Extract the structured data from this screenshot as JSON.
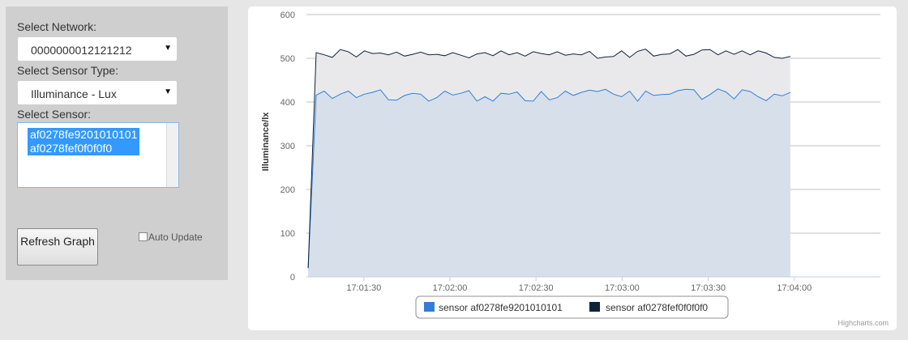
{
  "sidebar": {
    "network_label": "Select Network:",
    "network_value": "0000000012121212",
    "sensor_type_label": "Select Sensor Type:",
    "sensor_type_value": "Illuminance - Lux",
    "sensor_label": "Select Sensor:",
    "sensors": [
      "af0278fe9201010101",
      "af0278fef0f0f0f0"
    ],
    "refresh_label": "Refresh Graph",
    "auto_update_label": "Auto Update",
    "auto_update_checked": false
  },
  "credits": "Highcharts.com",
  "chart_data": {
    "type": "area",
    "title": "",
    "xlabel": "",
    "ylabel": "Illuminance/lx",
    "ylim": [
      0,
      600
    ],
    "yticks": [
      "0",
      "100",
      "200",
      "300",
      "400",
      "500",
      "600"
    ],
    "xlim": [
      "17:01:10",
      "17:04:30"
    ],
    "xtick_labels": [
      "17:01:30",
      "17:02:00",
      "17:02:30",
      "17:03:00",
      "17:03:30",
      "17:04:00"
    ],
    "grid": true,
    "legend": "bottom-center",
    "interval_seconds": 2.8,
    "series": [
      {
        "name": "sensor af0278fe9201010101",
        "color": "#2f7ed8",
        "fill": "#d7dfeb",
        "values": [
          20,
          416,
          425,
          408,
          418,
          425,
          410,
          418,
          422,
          428,
          405,
          404,
          415,
          420,
          418,
          402,
          410,
          425,
          416,
          420,
          426,
          402,
          412,
          402,
          420,
          418,
          423,
          403,
          402,
          424,
          405,
          410,
          425,
          415,
          422,
          427,
          424,
          429,
          418,
          412,
          425,
          402,
          425,
          415,
          417,
          418,
          426,
          429,
          428,
          406,
          417,
          430,
          423,
          407,
          428,
          424,
          412,
          403,
          418,
          414,
          422
        ]
      },
      {
        "name": "sensor af0278fef0f0f0f0",
        "color": "#0d233a",
        "fill": "#e9e9ec",
        "values": [
          20,
          513,
          508,
          502,
          520,
          515,
          503,
          517,
          511,
          512,
          508,
          514,
          505,
          509,
          514,
          508,
          509,
          506,
          513,
          507,
          501,
          510,
          513,
          506,
          517,
          508,
          513,
          505,
          515,
          511,
          508,
          515,
          507,
          510,
          508,
          516,
          500,
          503,
          504,
          517,
          502,
          516,
          521,
          505,
          509,
          510,
          520,
          505,
          509,
          519,
          520,
          508,
          517,
          509,
          517,
          508,
          517,
          512,
          502,
          500,
          504
        ]
      }
    ]
  }
}
